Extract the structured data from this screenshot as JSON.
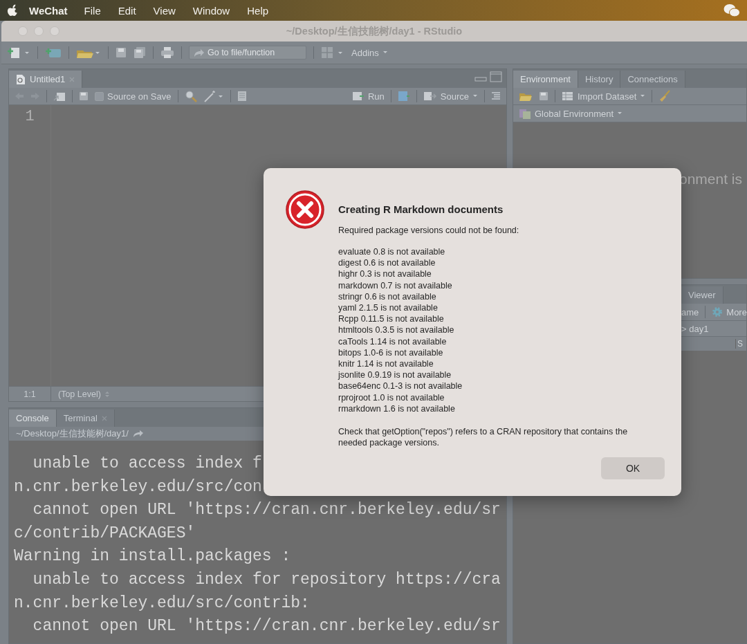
{
  "menubar": {
    "app": "WeChat",
    "items": [
      "File",
      "Edit",
      "View",
      "Window",
      "Help"
    ]
  },
  "window": {
    "title": "~/Desktop/生信技能树/day1 - RStudio"
  },
  "toolbar": {
    "goto_placeholder": "Go to file/function",
    "addins": "Addins"
  },
  "editor": {
    "tabs": [
      {
        "label": "Untitled1",
        "selected": true
      }
    ],
    "source_on_save": {
      "label": "Source on Save",
      "checked": false
    },
    "run": "Run",
    "source": "Source",
    "line_numbers": [
      "1"
    ],
    "position": "1:1",
    "scope": "(Top Level)"
  },
  "console": {
    "tabs": [
      {
        "label": "Console",
        "selected": true
      },
      {
        "label": "Terminal",
        "selected": false
      }
    ],
    "path": "~/Desktop/生信技能树/day1/",
    "lines": [
      "  unable to access index f",
      "n.cnr.berkeley.edu/src/con",
      "  cannot open URL 'https://cran.cnr.berkeley.edu/sr",
      "c/contrib/PACKAGES'",
      "Warning in install.packages :",
      "  unable to access index for repository https://cra",
      "n.cnr.berkeley.edu/src/contrib:",
      "  cannot open URL 'https://cran.cnr.berkeley.edu/sr"
    ]
  },
  "environment": {
    "tabs": [
      {
        "label": "Environment",
        "selected": true
      },
      {
        "label": "History",
        "selected": false
      },
      {
        "label": "Connections",
        "selected": false
      }
    ],
    "import_dataset": "Import Dataset",
    "scope": "Global Environment",
    "message": "onment is"
  },
  "files": {
    "tabs": [
      {
        "label": "Viewer",
        "selected": false
      }
    ],
    "rename": "ame",
    "more": "More",
    "breadcrumb": "> day1",
    "column_header": "S"
  },
  "dialog": {
    "title": "Creating R Markdown documents",
    "message": "Required package versions could not be found:",
    "items": [
      "evaluate 0.8 is not available",
      "digest 0.6 is not available",
      "highr 0.3 is not available",
      "markdown 0.7 is not available",
      "stringr 0.6 is not available",
      "yaml 2.1.5 is not available",
      "Rcpp 0.11.5 is not available",
      "htmltools 0.3.5 is not available",
      "caTools 1.14 is not available",
      "bitops 1.0-6 is not available",
      "knitr 1.14 is not available",
      "jsonlite 0.9.19 is not available",
      "base64enc 0.1-3 is not available",
      "rprojroot 1.0 is not available",
      "rmarkdown 1.6 is not available"
    ],
    "note": "Check that getOption(\"repos\") refers to a CRAN repository that contains the needed package versions.",
    "button": "OK"
  }
}
